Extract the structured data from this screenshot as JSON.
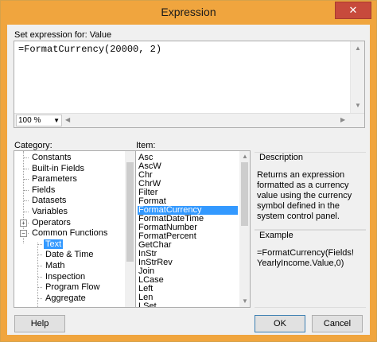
{
  "window": {
    "title": "Expression",
    "close_glyph": "✕"
  },
  "expression": {
    "label": "Set expression for: Value",
    "value": "=FormatCurrency(20000, 2)",
    "zoom": "100 %"
  },
  "category": {
    "label": "Category:",
    "items": [
      {
        "label": "Constants",
        "level": 1,
        "selected": false,
        "expander": ""
      },
      {
        "label": "Built-in Fields",
        "level": 1,
        "selected": false,
        "expander": ""
      },
      {
        "label": "Parameters",
        "level": 1,
        "selected": false,
        "expander": ""
      },
      {
        "label": "Fields",
        "level": 1,
        "selected": false,
        "expander": ""
      },
      {
        "label": "Datasets",
        "level": 1,
        "selected": false,
        "expander": ""
      },
      {
        "label": "Variables",
        "level": 1,
        "selected": false,
        "expander": ""
      },
      {
        "label": "Operators",
        "level": 1,
        "selected": false,
        "expander": "+"
      },
      {
        "label": "Common Functions",
        "level": 1,
        "selected": false,
        "expander": "−"
      },
      {
        "label": "Text",
        "level": 2,
        "selected": true,
        "expander": ""
      },
      {
        "label": "Date & Time",
        "level": 2,
        "selected": false,
        "expander": ""
      },
      {
        "label": "Math",
        "level": 2,
        "selected": false,
        "expander": ""
      },
      {
        "label": "Inspection",
        "level": 2,
        "selected": false,
        "expander": ""
      },
      {
        "label": "Program Flow",
        "level": 2,
        "selected": false,
        "expander": ""
      },
      {
        "label": "Aggregate",
        "level": 2,
        "selected": false,
        "expander": ""
      }
    ]
  },
  "item": {
    "label": "Item:",
    "items": [
      "Asc",
      "AscW",
      "Chr",
      "ChrW",
      "Filter",
      "Format",
      "FormatCurrency",
      "FormatDateTime",
      "FormatNumber",
      "FormatPercent",
      "GetChar",
      "InStr",
      "InStrRev",
      "Join",
      "LCase",
      "Left",
      "Len",
      "LSet"
    ],
    "selected_index": 6
  },
  "description": {
    "title": "Description",
    "text": "Returns an expression formatted as a currency value using the currency symbol defined in the system control panel."
  },
  "example": {
    "title": "Example",
    "text": "=FormatCurrency(Fields!YearlyIncome.Value,0)"
  },
  "buttons": {
    "help": "Help",
    "ok": "OK",
    "cancel": "Cancel"
  },
  "colors": {
    "titlebar": "#f0a53e",
    "selection": "#3399ff",
    "close": "#c74a3c"
  }
}
